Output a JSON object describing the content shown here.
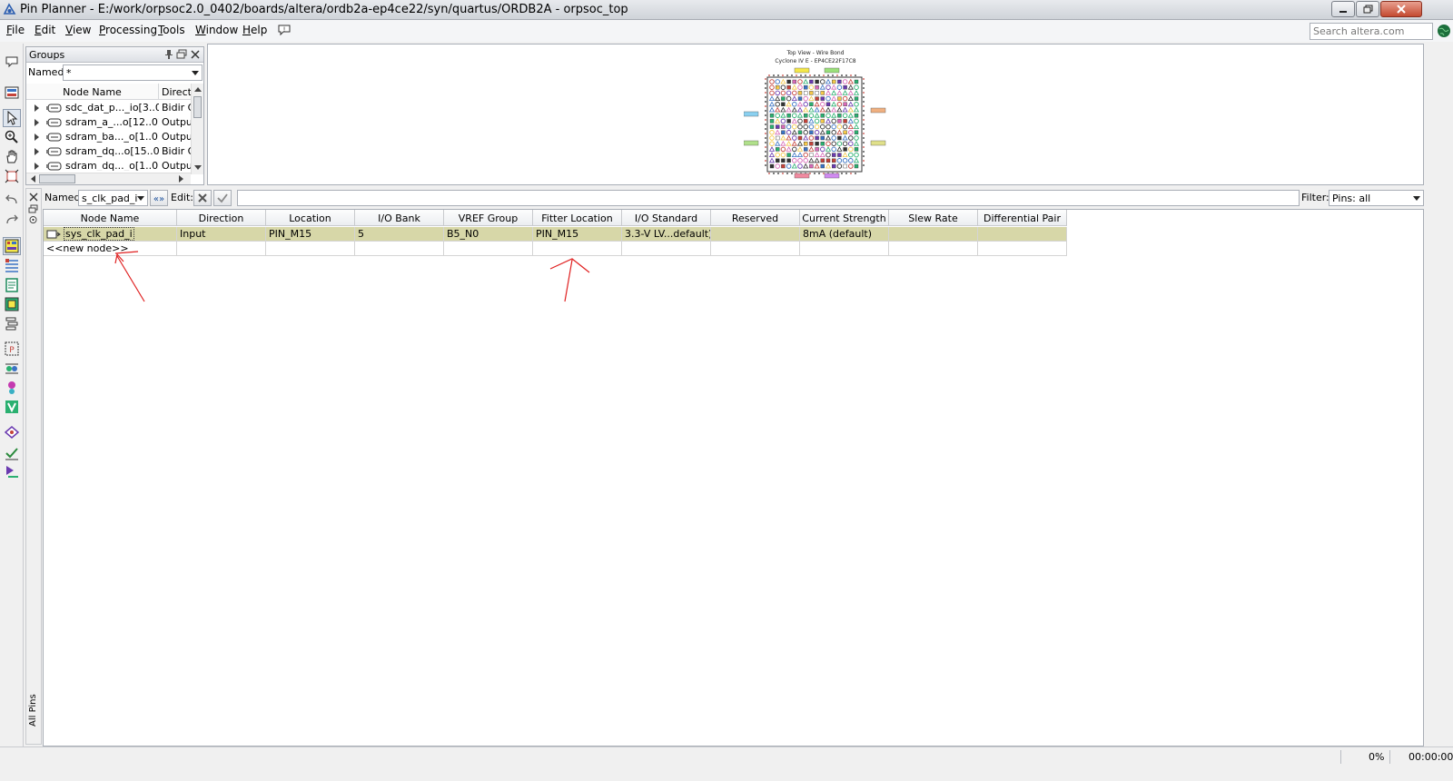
{
  "window": {
    "title": "Pin Planner - E:/work/orpsoc2.0_0402/boards/altera/ordb2a-ep4ce22/syn/quartus/ORDB2A - orpsoc_top"
  },
  "menu": [
    "File",
    "Edit",
    "View",
    "Processing",
    "Tools",
    "Window",
    "Help"
  ],
  "search": {
    "placeholder": "Search altera.com"
  },
  "groups_panel": {
    "title": "Groups",
    "named_label": "Named:",
    "named_value": "*",
    "col_node": "Node Name",
    "col_dir": "Direction",
    "rows": [
      {
        "name": "sdc_dat_p..._io[3..0]",
        "dir": "Bidir G"
      },
      {
        "name": "sdram_a_...o[12..0]",
        "dir": "Outpu"
      },
      {
        "name": "sdram_ba..._o[1..0]",
        "dir": "Outpu"
      },
      {
        "name": "sdram_dq...o[15..0]",
        "dir": "Bidir G"
      },
      {
        "name": "sdram_dq..._o[1..0]",
        "dir": "Outpu"
      }
    ]
  },
  "package_view": {
    "title": "Top View - Wire Bond",
    "subtitle": "Cyclone IV E - EP4CE22F17C8"
  },
  "filter_bar": {
    "named_label": "Named:",
    "named_value": "s_clk_pad_i",
    "edit_label": "Edit:",
    "filter_label": "Filter:",
    "filter_value": "Pins: all"
  },
  "table": {
    "columns": [
      "Node Name",
      "Direction",
      "Location",
      "I/O Bank",
      "VREF Group",
      "Fitter Location",
      "I/O Standard",
      "Reserved",
      "Current Strength",
      "Slew Rate",
      "Differential Pair"
    ],
    "rows": [
      [
        "sys_clk_pad_i",
        "Input",
        "PIN_M15",
        "5",
        "B5_N0",
        "PIN_M15",
        "3.3-V LV...default)",
        "",
        "8mA (default)",
        "",
        ""
      ]
    ],
    "new_node": "<<new node>>"
  },
  "side_tab": "All Pins",
  "status": {
    "progress": "0%",
    "time": "00:00:00"
  },
  "colors": {
    "selected_row": "#d7d7a8",
    "annotation": "#e02020"
  }
}
